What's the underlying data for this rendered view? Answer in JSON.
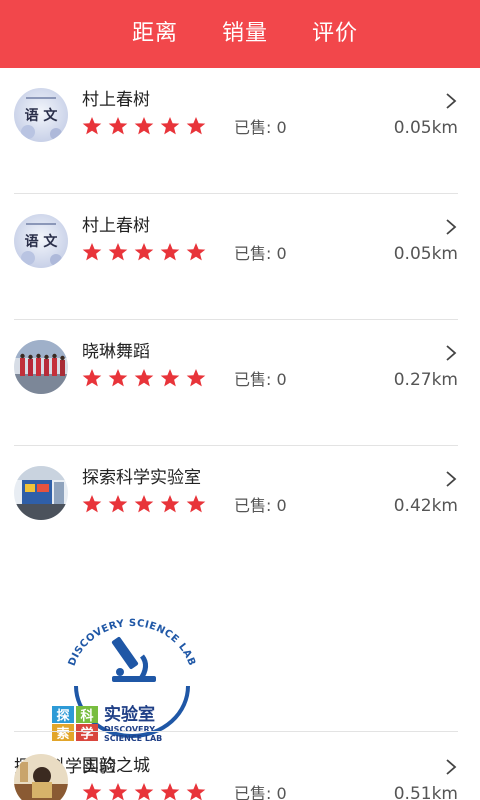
{
  "tabs": [
    "距离",
    "销量",
    "评价"
  ],
  "items": [
    {
      "name": "村上春树",
      "sold": "已售: 0",
      "distance": "0.05km",
      "rating": 5,
      "avatar_text": "语 文"
    },
    {
      "name": "村上春树",
      "sold": "已售: 0",
      "distance": "0.05km",
      "rating": 5,
      "avatar_text": "语 文"
    },
    {
      "name": "晓琳舞蹈",
      "sold": "已售: 0",
      "distance": "0.27km",
      "rating": 5,
      "avatar_text": ""
    },
    {
      "name": "探索科学实验室",
      "sold": "已售: 0",
      "distance": "0.42km",
      "rating": 5,
      "avatar_text": ""
    },
    {
      "name": "国韵之城",
      "sold": "已售: 0",
      "distance": "0.51km",
      "rating": 5,
      "avatar_text": ""
    }
  ],
  "banner": {
    "ring_text": "DISCOVERY SCIENCE LAB",
    "cn_left": [
      "探",
      "科",
      "索",
      "学"
    ],
    "cn_right": "实验室",
    "en_line1": "DISCOVERY",
    "en_line2": "SCIENCE LAB",
    "caption": "探索科学实验"
  },
  "colors": {
    "header": "#f2474b",
    "star": "#e8343a"
  }
}
